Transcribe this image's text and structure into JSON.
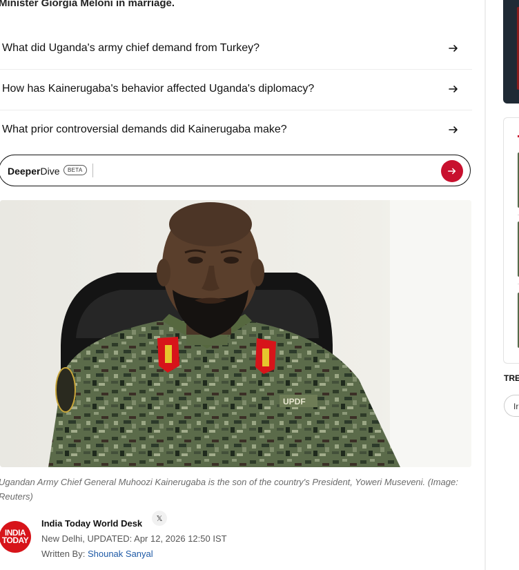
{
  "article": {
    "intro_fragment": "Minister Giorgia Meloni in marriage."
  },
  "questions": [
    {
      "text": "What did Uganda's army chief demand from Turkey?",
      "icon": "arrow-right-icon"
    },
    {
      "text": "How has Kainerugaba's behavior affected Uganda's diplomacy?",
      "icon": "arrow-right-icon"
    },
    {
      "text": "What prior controversial demands did Kainerugaba make?",
      "icon": "arrow-right-icon"
    }
  ],
  "deeper_dive": {
    "brand_bold": "Deeper",
    "brand_light": "Dive",
    "badge": "BETA",
    "input_value": "",
    "send_icon": "arrow-right-icon",
    "accent": "#c8102e"
  },
  "image": {
    "caption": "Ugandan Army Chief General Muhoozi Kainerugaba is the son of the country's President, Yoweri Museveni. (Image: Reuters)",
    "patch_text": "UPDF"
  },
  "byline": {
    "logo_line1": "INDIA",
    "logo_line2": "TODAY",
    "author": "India Today World Desk",
    "social_icon": "x-icon",
    "location": "New Delhi,",
    "updated": "UPDATED: Apr 12, 2026 12:50 IST",
    "written_by_label": "Written By:",
    "writer": "Shounak Sanyal",
    "logo_color": "#d7141a",
    "link_color": "#1f5aa6"
  },
  "rail": {
    "trending_label": "TRE",
    "chip_text": "Ir"
  }
}
